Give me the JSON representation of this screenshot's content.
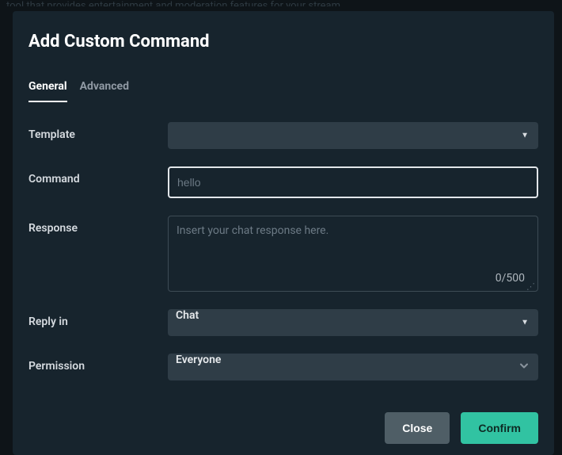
{
  "bg_text": "tool that provides entertainment and moderation features for your stream",
  "modal": {
    "title": "Add Custom Command"
  },
  "tabs": {
    "general": "General",
    "advanced": "Advanced"
  },
  "labels": {
    "template": "Template",
    "command": "Command",
    "response": "Response",
    "reply_in": "Reply in",
    "permission": "Permission"
  },
  "fields": {
    "template": {
      "selected": ""
    },
    "command": {
      "value": "",
      "placeholder": "hello"
    },
    "response": {
      "value": "",
      "placeholder": "Insert your chat response here.",
      "counter": "0/500"
    },
    "reply_in": {
      "selected": "Chat"
    },
    "permission": {
      "selected": "Everyone"
    }
  },
  "buttons": {
    "close": "Close",
    "confirm": "Confirm"
  }
}
